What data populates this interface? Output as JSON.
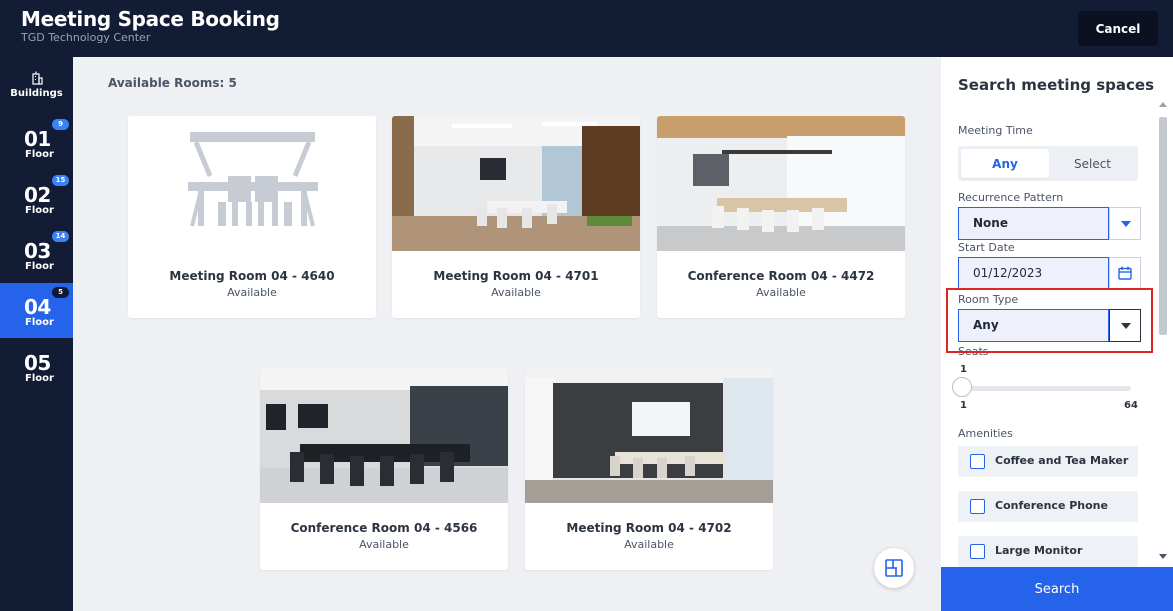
{
  "header": {
    "title": "Meeting Space Booking",
    "subtitle": "TGD Technology Center",
    "cancel_label": "Cancel"
  },
  "rail": {
    "buildings_label": "Buildings",
    "floors": [
      {
        "number": "01",
        "label": "Floor",
        "badge": "9",
        "active": false
      },
      {
        "number": "02",
        "label": "Floor",
        "badge": "15",
        "active": false
      },
      {
        "number": "03",
        "label": "Floor",
        "badge": "14",
        "active": false
      },
      {
        "number": "04",
        "label": "Floor",
        "badge": "5",
        "active": true
      },
      {
        "number": "05",
        "label": "Floor",
        "badge": "",
        "active": false
      }
    ]
  },
  "main": {
    "available_rooms_label": "Available Rooms: 5",
    "rooms": [
      {
        "name": "Meeting Room 04 - 4640",
        "status": "Available",
        "image": "placeholder-furniture-icon"
      },
      {
        "name": "Meeting Room 04 - 4701",
        "status": "Available",
        "image": "room-photo"
      },
      {
        "name": "Conference Room 04 - 4472",
        "status": "Available",
        "image": "room-photo"
      },
      {
        "name": "Conference Room 04 - 4566",
        "status": "Available",
        "image": "room-photo"
      },
      {
        "name": "Meeting Room 04 - 4702",
        "status": "Available",
        "image": "room-photo"
      }
    ]
  },
  "panel": {
    "title": "Search meeting spaces",
    "meeting_time_label": "Meeting Time",
    "meeting_time_options": [
      "Any",
      "Select"
    ],
    "meeting_time_selected": "Any",
    "recurrence_label": "Recurrence Pattern",
    "recurrence_value": "None",
    "start_date_label": "Start Date",
    "start_date_value": "01/12/2023",
    "room_type_label": "Room Type",
    "room_type_value": "Any",
    "seats_label": "Seats",
    "seats_value": "1",
    "seats_min": "1",
    "seats_max": "64",
    "amenities_label": "Amenities",
    "amenities": [
      "Coffee and Tea Maker",
      "Conference Phone",
      "Large Monitor"
    ],
    "search_label": "Search"
  },
  "colors": {
    "header_bg": "#131c35",
    "accent": "#2563eb",
    "highlight": "#dc2626"
  }
}
